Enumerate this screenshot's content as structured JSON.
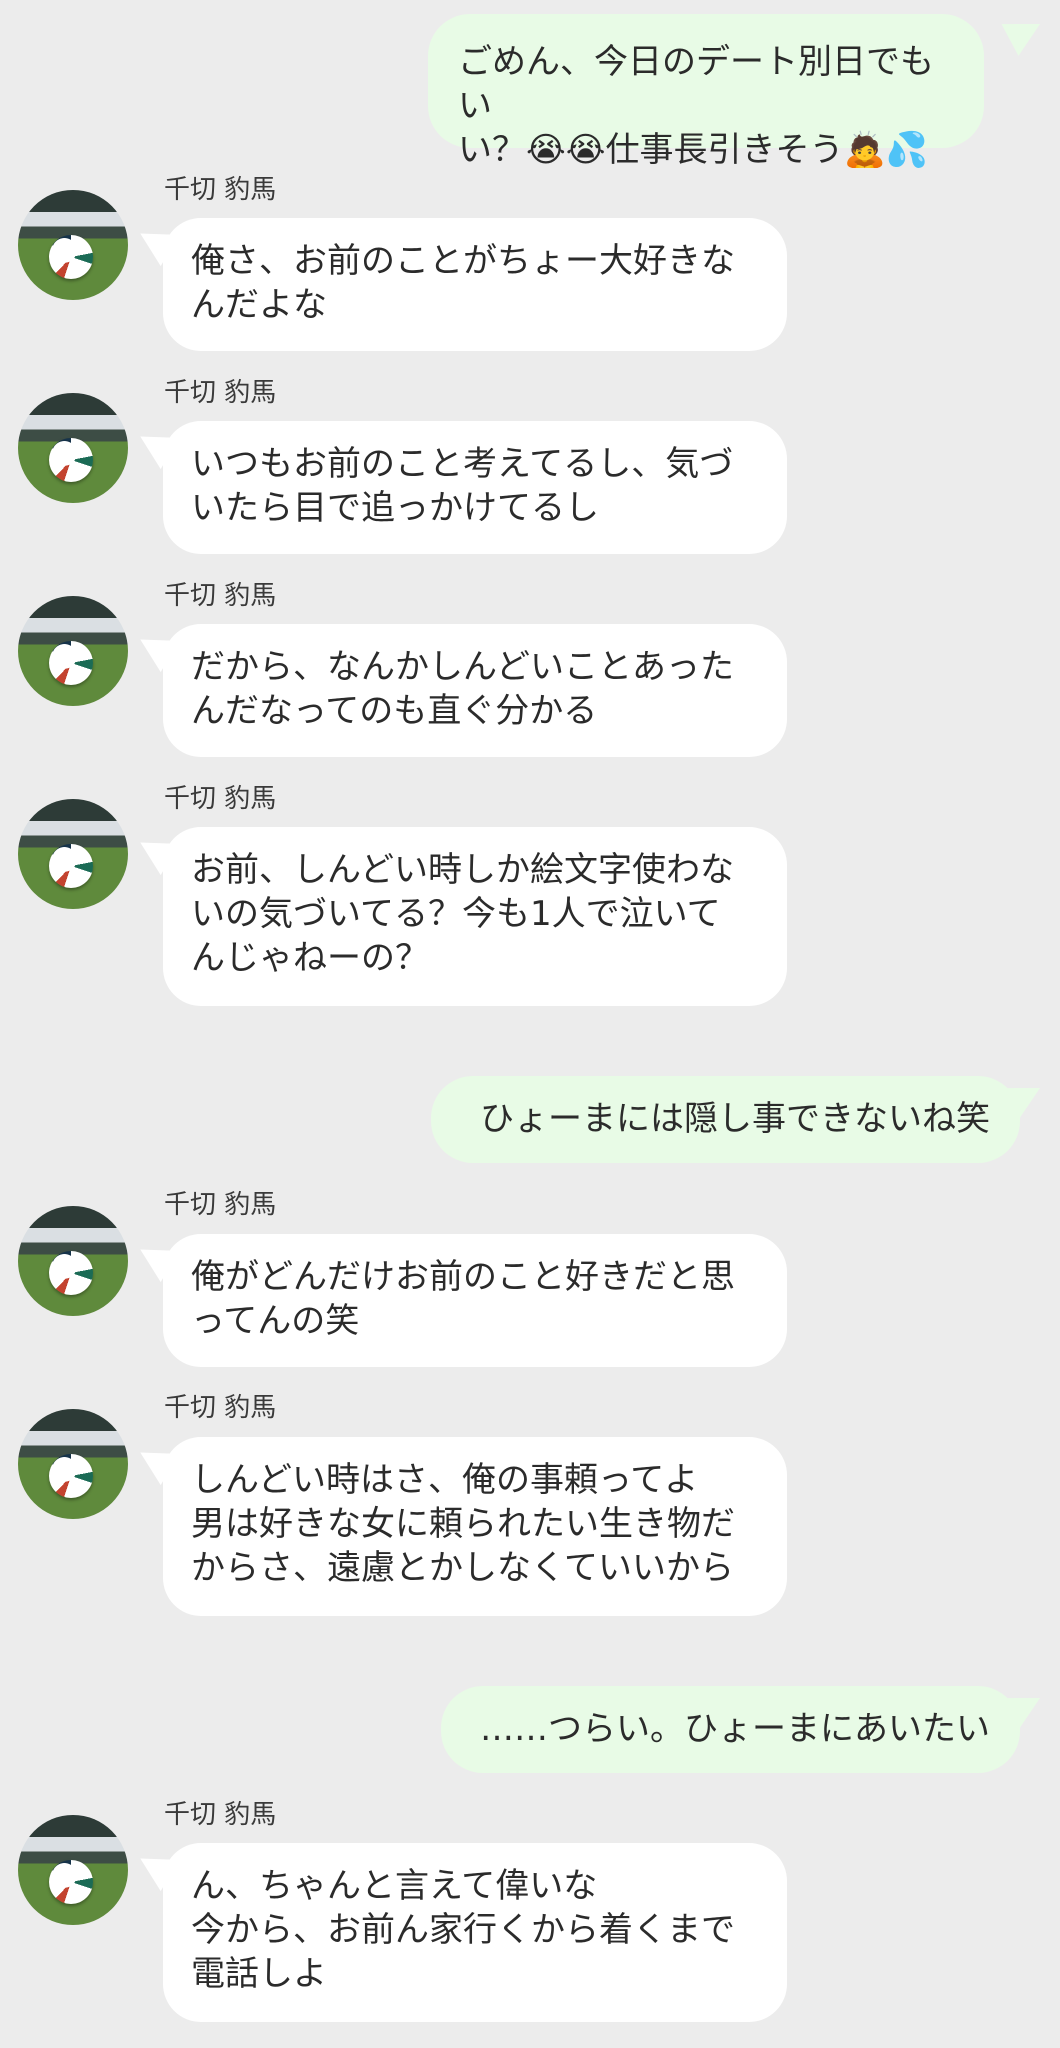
{
  "contact_name": "千切 豹馬",
  "messages": [
    {
      "side": "out",
      "text": "ごめん、今日のデート別日でもい\nい？😭😭仕事長引きそう🙇💦"
    },
    {
      "side": "in",
      "sender": "千切 豹馬",
      "text": "俺さ、お前のことがちょー大好きな\nんだよな"
    },
    {
      "side": "in",
      "sender": "千切 豹馬",
      "text": "いつもお前のこと考えてるし、気づ\nいたら目で追っかけてるし"
    },
    {
      "side": "in",
      "sender": "千切 豹馬",
      "text": "だから、なんかしんどいことあった\nんだなってのも直ぐ分かる"
    },
    {
      "side": "in",
      "sender": "千切 豹馬",
      "text": "お前、しんどい時しか絵文字使わな\nいの気づいてる？今も1人で泣いて\nんじゃねーの？"
    },
    {
      "side": "out",
      "text": "ひょーまには隠し事できないね笑"
    },
    {
      "side": "in",
      "sender": "千切 豹馬",
      "text": "俺がどんだけお前のこと好きだと思\nってんの笑"
    },
    {
      "side": "in",
      "sender": "千切 豹馬",
      "text": "しんどい時はさ、俺の事頼ってよ\n男は好きな女に頼られたい生き物だ\nからさ、遠慮とかしなくていいから"
    },
    {
      "side": "out",
      "text": "……つらい。ひょーまにあいたい"
    },
    {
      "side": "in",
      "sender": "千切 豹馬",
      "text": "ん、ちゃんと言えて偉いな\n今から、お前ん家行くから着くまで\n電話しよ"
    }
  ],
  "colors": {
    "background": "#ececec",
    "sent_bubble": "#e8fbe6",
    "received_bubble": "#ffffff",
    "text": "#2b2b2b"
  },
  "icons": {
    "avatar": "soccer-ball-avatar"
  }
}
